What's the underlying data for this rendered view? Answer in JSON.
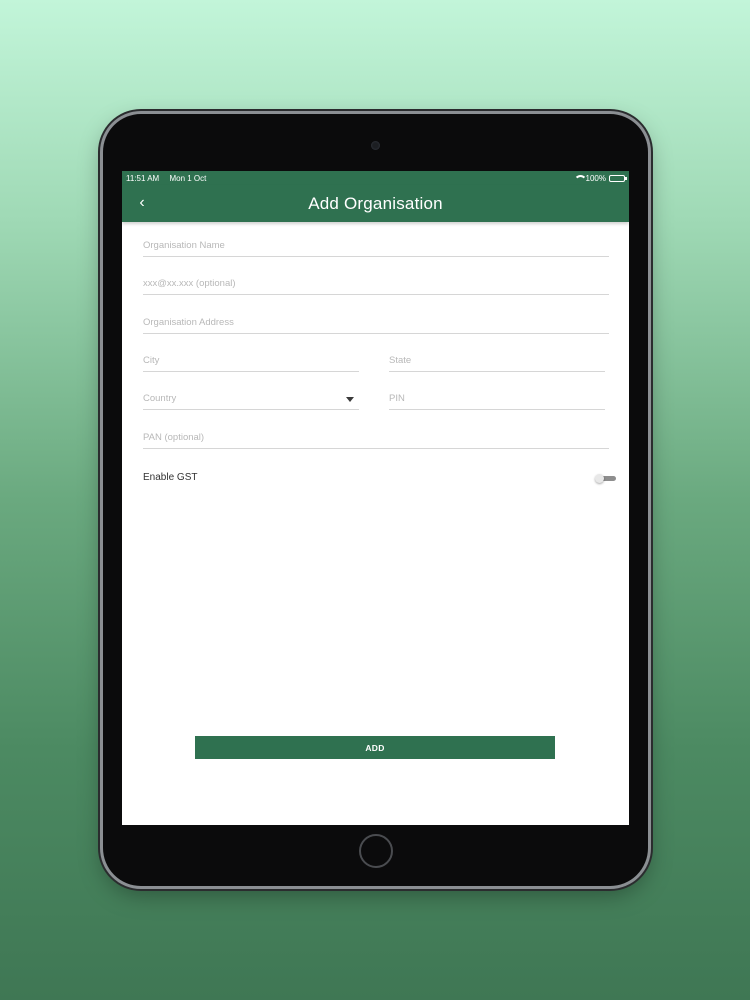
{
  "status_bar": {
    "time": "11:51 AM",
    "date": "Mon 1 Oct",
    "battery": "100%"
  },
  "header": {
    "back_icon": "‹",
    "title": "Add Organisation"
  },
  "form": {
    "organisation_name_placeholder": "Organisation Name",
    "email_placeholder": "xxx@xx.xxx (optional)",
    "address_placeholder": "Organisation Address",
    "city_placeholder": "City",
    "state_placeholder": "State",
    "country_placeholder": "Country",
    "pin_placeholder": "PIN",
    "pan_placeholder": "PAN (optional)",
    "gst_label": "Enable GST",
    "gst_enabled": false
  },
  "actions": {
    "add_label": "ADD"
  },
  "colors": {
    "brand": "#2f7150",
    "background_top": "#c2f5d9",
    "background_bottom": "#3f7754"
  }
}
